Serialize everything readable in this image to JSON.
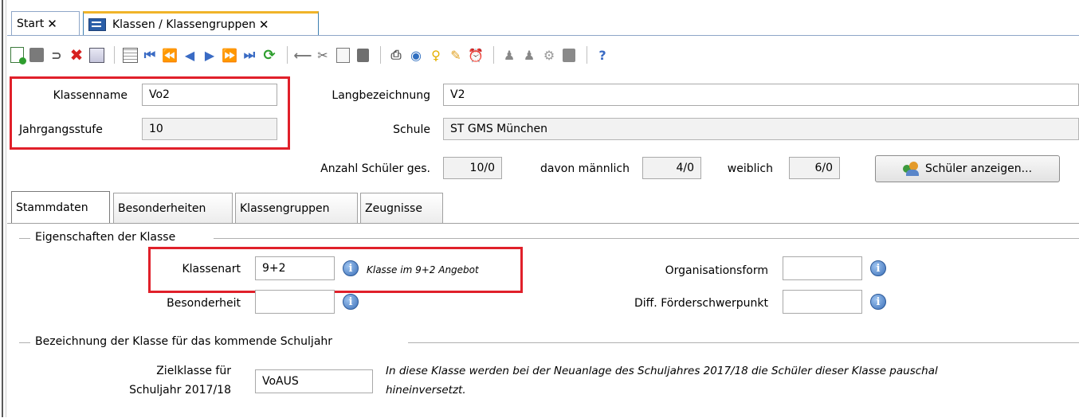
{
  "tabs": [
    {
      "label": "Start"
    },
    {
      "label": "Klassen / Klassengruppen"
    }
  ],
  "close_glyph": "✕",
  "toolbar": {
    "icons": [
      "new-icon",
      "save-icon",
      "undo-icon",
      "delete-icon",
      "list-icon",
      "grid-icon",
      "first-record-icon",
      "prev-page-icon",
      "prev-record-icon",
      "next-record-icon",
      "next-page-icon",
      "last-record-icon",
      "refresh-icon",
      "back-arrow-icon",
      "cut-icon",
      "copy-icon",
      "paste-icon",
      "print-icon",
      "preview-icon",
      "hint-icon",
      "clear-icon",
      "timer-icon",
      "users-icon",
      "users2-icon",
      "settings-icon",
      "notes-icon",
      "help-icon"
    ]
  },
  "header": {
    "klassenname_label": "Klassenname",
    "klassenname_value": "Vo2",
    "jahrgangsstufe_label": "Jahrgangsstufe",
    "jahrgangsstufe_value": "10",
    "langbezeichnung_label": "Langbezeichnung",
    "langbezeichnung_value": "V2",
    "schule_label": "Schule",
    "schule_value": "ST GMS München",
    "anzahl_label": "Anzahl Schüler ges.",
    "anzahl_value": "10/0",
    "maennlich_label": "davon männlich",
    "maennlich_value": "4/0",
    "weiblich_label": "weiblich",
    "weiblich_value": "6/0",
    "show_students_button": "Schüler anzeigen..."
  },
  "panel_tabs": [
    {
      "label": "Stammdaten"
    },
    {
      "label": "Besonderheiten"
    },
    {
      "label": "Klassengruppen"
    },
    {
      "label": "Zeugnisse"
    }
  ],
  "group1": {
    "title": "Eigenschaften der Klasse",
    "klassenart_label": "Klassenart",
    "klassenart_value": "9+2",
    "klassenart_hint": "Klasse im 9+2 Angebot",
    "besonderheit_label": "Besonderheit",
    "besonderheit_value": "",
    "organisationsform_label": "Organisationsform",
    "organisationsform_value": "",
    "foerder_label": "Diff. Förderschwerpunkt",
    "foerder_value": ""
  },
  "group2": {
    "title": "Bezeichnung der Klasse für das kommende Schuljahr",
    "zielklasse_label_line1": "Zielklasse für",
    "zielklasse_label_line2": "Schuljahr 2017/18",
    "zielklasse_value": "VoAUS",
    "note_line1": "In diese Klasse werden bei der Neuanlage des Schuljahres 2017/18 die Schüler dieser Klasse pauschal",
    "note_line2": "hineinversetzt."
  },
  "info_glyph": "i",
  "colors": {
    "highlight": "#e0202a",
    "tab_accent": "#f0b429"
  }
}
